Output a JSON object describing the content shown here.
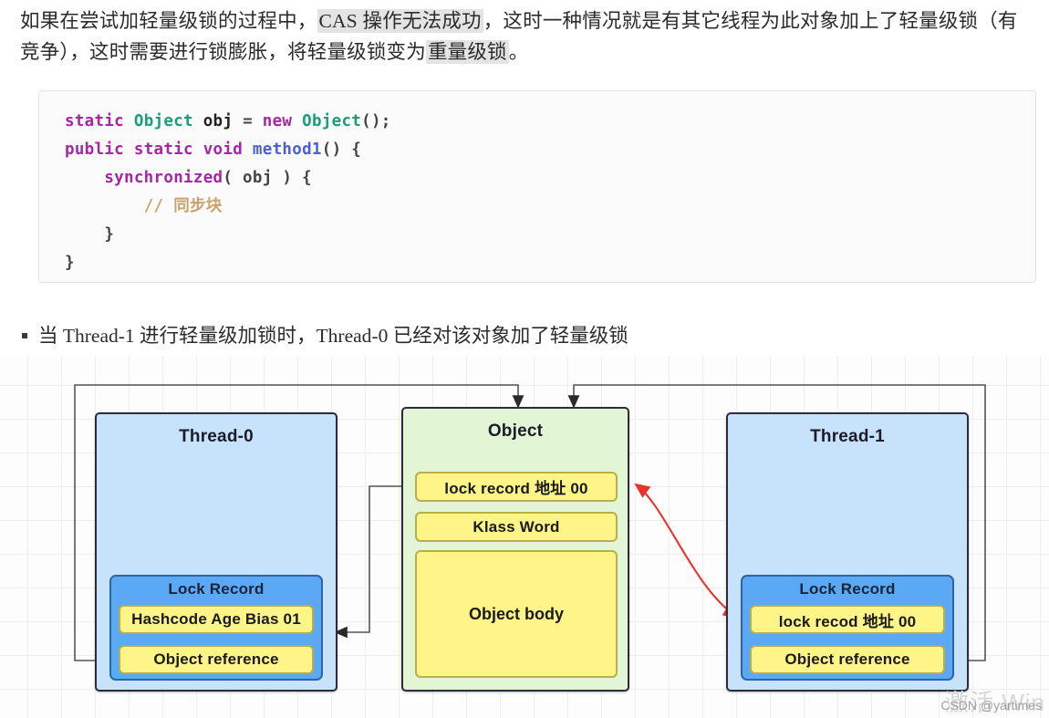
{
  "intro": {
    "part1": "如果在尝试加轻量级锁的过程中，",
    "highlight1": "CAS 操作无法成功",
    "part2": "，这时一种情况就是有其它线程为此对象加上了轻量级锁（有竞争），这时需要进行锁膨胀，将轻量级锁变为",
    "highlight2": "重量级锁",
    "part3": "。"
  },
  "code": {
    "line1_kw_static": "static",
    "line1_type": "Object",
    "line1_var": "obj",
    "line1_eq": "=",
    "line1_new": "new",
    "line1_type2": "Object",
    "line1_tail": "();",
    "line2_public": "public",
    "line2_static": "static",
    "line2_void": "void",
    "line2_method": "method1",
    "line2_tail": "() {",
    "line3_sync": "synchronized",
    "line3_tail": "( obj ) {",
    "line4_comment": "// 同步块",
    "line5": "}",
    "line6": "}"
  },
  "bullet": {
    "text": "当 Thread-1 进行轻量级加锁时，Thread-0 已经对该对象加了轻量级锁"
  },
  "diagram": {
    "thread0": {
      "title": "Thread-0",
      "lock_record_title": "Lock Record",
      "row1": "Hashcode Age Bias 01",
      "row2": "Object reference"
    },
    "object": {
      "title": "Object",
      "row1": "lock record 地址 00",
      "row2": "Klass Word",
      "row3": "Object body"
    },
    "thread1": {
      "title": "Thread-1",
      "lock_record_title": "Lock Record",
      "row1": "lock recod 地址 00",
      "row2": "Object reference"
    },
    "colors": {
      "thread_fill": "#c7e2fb",
      "object_fill": "#e2f5d4",
      "lock_record_fill": "#5ba9f5",
      "row_fill": "#fdf587",
      "box_border": "#2c2c3a",
      "red_arrow": "#e8342a",
      "connector": "#4a4a4a",
      "highlight": "#e4e4e4"
    }
  },
  "watermark": {
    "csdn": "CSDN @yartimes",
    "windows": "激活 Win"
  }
}
